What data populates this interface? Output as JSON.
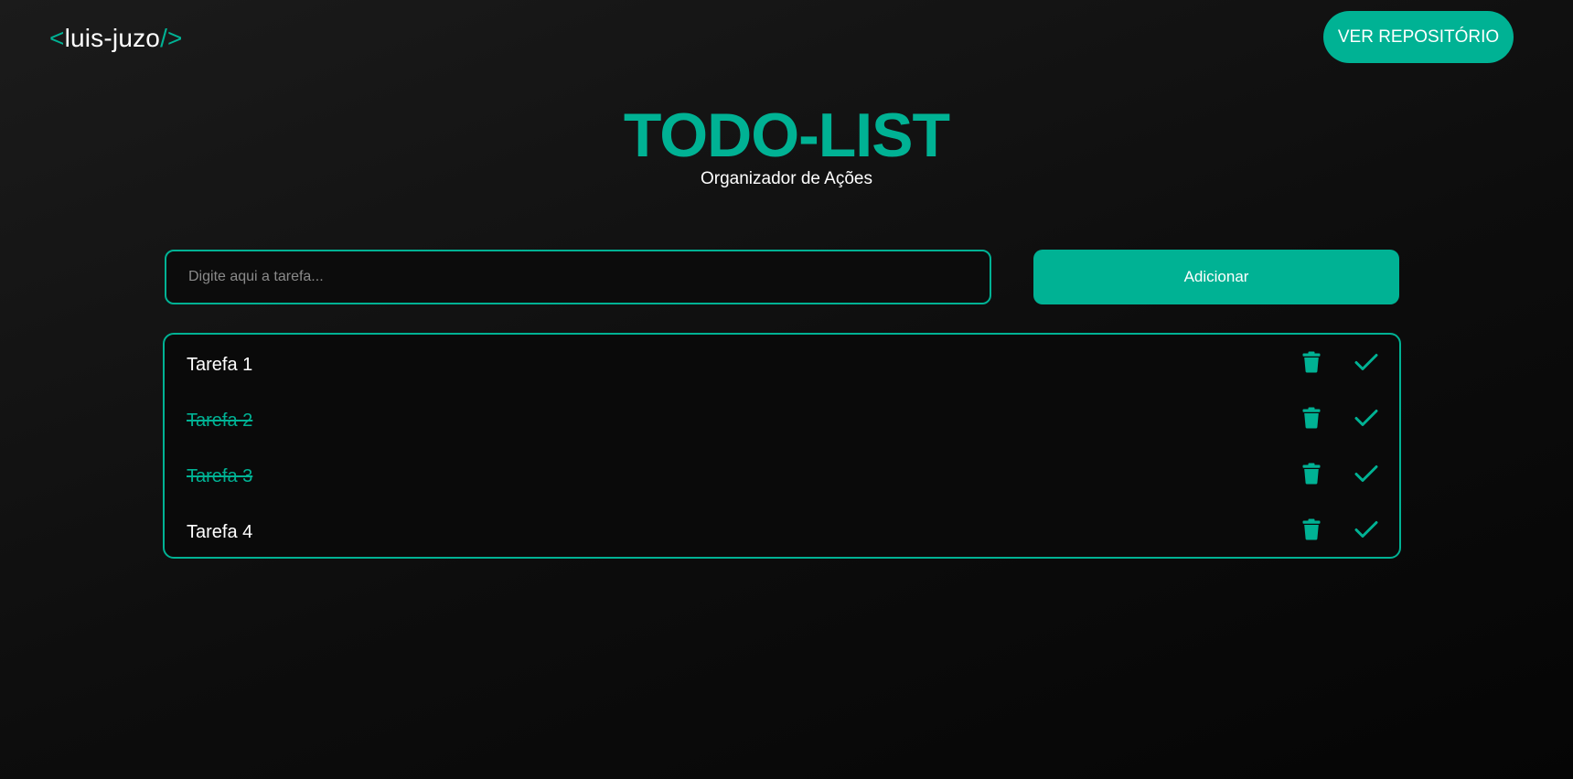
{
  "header": {
    "logo": {
      "open_bracket": "<",
      "name": "luis-juzo",
      "close_bracket": "/>"
    },
    "repo_button_label": "VER REPOSITÓRIO"
  },
  "main": {
    "title": "TODO-LIST",
    "subtitle": "Organizador de Ações",
    "input": {
      "value": "",
      "placeholder": "Digite aqui a tarefa..."
    },
    "add_button_label": "Adicionar",
    "tasks": [
      {
        "text": "Tarefa 1",
        "done": false
      },
      {
        "text": "Tarefa 2",
        "done": true
      },
      {
        "text": "Tarefa 3",
        "done": true
      },
      {
        "text": "Tarefa 4",
        "done": false
      }
    ]
  },
  "icons": {
    "delete": "trash-icon",
    "complete": "check-icon"
  },
  "colors": {
    "accent": "#00b294",
    "background": "#0d0d0d",
    "text": "#ffffff",
    "placeholder": "#8a8a8a"
  }
}
